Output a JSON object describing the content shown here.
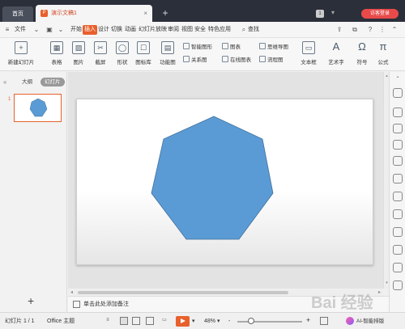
{
  "titlebar": {
    "home_tab": "首页",
    "doc_tab": "演示文稿1",
    "doc_icon": "P",
    "close": "×",
    "add": "+",
    "badge": "1",
    "login": "访客登录"
  },
  "menubar": {
    "file": "文件",
    "items": [
      "开始",
      "插入",
      "设计",
      "切换",
      "动画",
      "幻灯片放映",
      "审阅",
      "视图",
      "安全",
      "特色应用"
    ],
    "active": "插入",
    "search": "查找",
    "help": "?"
  },
  "ribbon": {
    "new_slide": "新建幻灯片",
    "table": "表格",
    "picture": "图片",
    "screenshot": "截屏",
    "shape": "形状",
    "icon_lib": "图标库",
    "func_chart": "功能图",
    "smart_graphic": "智能图形",
    "chart": "图表",
    "mind_map": "思维导图",
    "relation_chart": "关系图",
    "online_chart": "在线图表",
    "flow_chart": "流程图",
    "text_box": "文本框",
    "art_text": "艺术字",
    "symbol": "符号",
    "formula": "公式",
    "formula_glyph": "π",
    "symbol_glyph": "Ω",
    "art_glyph": "A"
  },
  "leftpanel": {
    "outline_tab": "大纲",
    "slides_tab": "幻灯片",
    "slide_number": "1",
    "add": "+"
  },
  "notes": {
    "placeholder": "单击此处添加备注"
  },
  "statusbar": {
    "slide_info": "幻灯片 1 / 1",
    "theme": "Office 主题",
    "zoom": "48%",
    "zoom_minus": "-",
    "zoom_plus": "+",
    "ai": "AI-智能排版"
  },
  "watermark": "Bai 经验",
  "colors": {
    "accent": "#e8602c",
    "shape_fill": "#5b9bd5",
    "shape_stroke": "#41719c",
    "login": "#e84a4a",
    "titlebar": "#2b2f3a"
  }
}
